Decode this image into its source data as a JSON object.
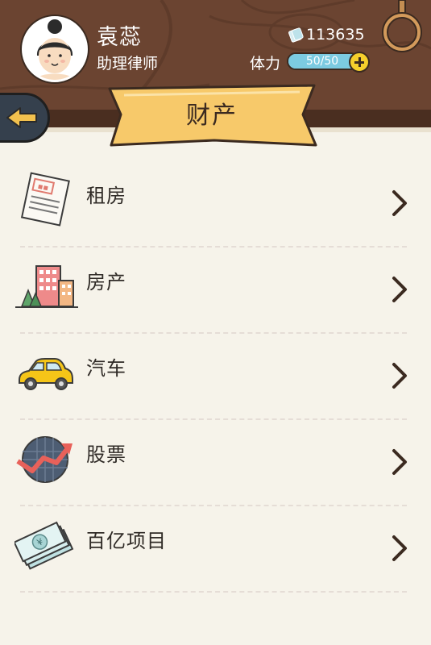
{
  "player": {
    "name": "袁蕊",
    "title": "助理律师",
    "money": "113635",
    "stamina_label": "体力",
    "stamina_text": "50/50",
    "stamina_fraction": 1.0
  },
  "page": {
    "title": "财产"
  },
  "menu": {
    "items": [
      {
        "label": "租房",
        "icon": "rent-notice-icon"
      },
      {
        "label": "房产",
        "icon": "buildings-icon"
      },
      {
        "label": "汽车",
        "icon": "car-icon"
      },
      {
        "label": "股票",
        "icon": "stock-chart-icon"
      },
      {
        "label": "百亿项目",
        "icon": "money-bills-icon"
      }
    ]
  },
  "colors": {
    "header_bg": "#6b4431",
    "banner_yellow": "#f7c96a",
    "stamina_blue": "#6fc1d9",
    "page_bg": "#f6f3ea"
  }
}
